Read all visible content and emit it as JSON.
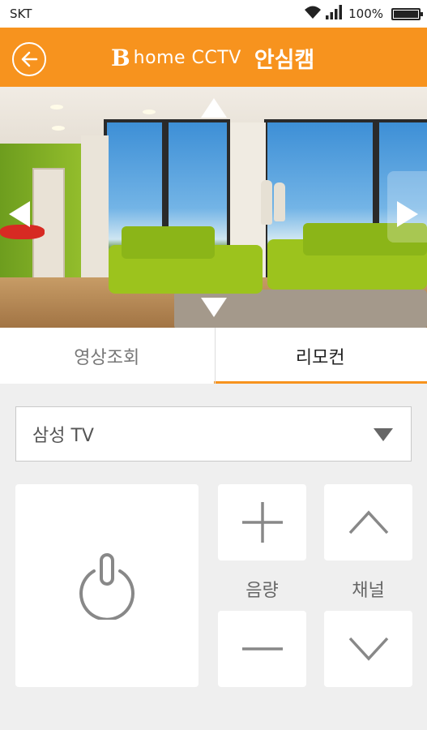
{
  "status_bar": {
    "carrier": "SKT",
    "battery_percent": "100%",
    "battery_level": 1.0,
    "icons": [
      "wifi-icon",
      "signal-icon",
      "battery-icon"
    ]
  },
  "header": {
    "logo_mark": "B",
    "logo_text": "home CCTV",
    "title": "안심캠",
    "back_icon": "back-arrow-circle-icon",
    "accent_color": "#f7931e"
  },
  "video": {
    "controls": [
      "pan-up-icon",
      "pan-down-icon",
      "pan-left-icon",
      "pan-right-icon"
    ]
  },
  "tabs": [
    {
      "label": "영상조회",
      "active": false
    },
    {
      "label": "리모컨",
      "active": true
    }
  ],
  "device_select": {
    "value": "삼성 TV",
    "icon": "dropdown-caret-icon"
  },
  "remote": {
    "power_icon": "power-icon",
    "volume_label": "음량",
    "channel_label": "채널",
    "volume_up_icon": "plus-icon",
    "volume_down_icon": "minus-icon",
    "channel_up_icon": "chevron-up-icon",
    "channel_down_icon": "chevron-down-icon"
  }
}
